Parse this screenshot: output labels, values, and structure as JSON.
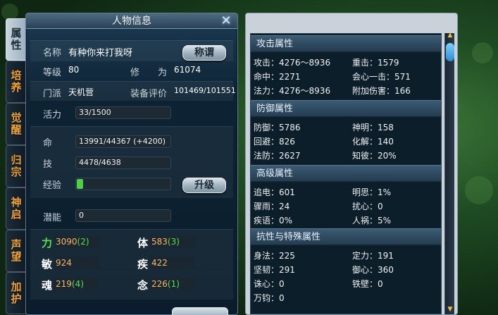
{
  "panel": {
    "title": "人物信息",
    "close_icon": "close-icon"
  },
  "tabs": [
    "属性",
    "培养",
    "觉醒",
    "归宗",
    "神启",
    "声望",
    "加护"
  ],
  "profile": {
    "name_label": "名称",
    "name_value": "有种你来打我呀",
    "title_button": "称谓",
    "level_label": "等级",
    "level_value": "80",
    "cultivation_label": "修　　为",
    "cultivation_value": "61074",
    "sect_label": "门派",
    "sect_value": "天机营",
    "gear_label": "装备评价",
    "gear_value": "101469/101551",
    "vitality_label": "活力",
    "vitality_value": "33/1500",
    "life_label": "命",
    "life_value": "13991/44367 (+4200)",
    "skill_label": "技",
    "skill_value": "4478/4638",
    "exp_label": "经验",
    "exp_fraction": 0.07,
    "upgrade_button": "升级",
    "potential_label": "潜能",
    "potential_value": "0"
  },
  "stats": {
    "strength_label": "力",
    "strength_value": "3090",
    "strength_bonus": "(2)",
    "physique_label": "体",
    "physique_value": "583",
    "physique_bonus": "(3)",
    "agility_label": "敏",
    "agility_value": "924",
    "speed_label": "疾",
    "speed_value": "422",
    "soul_label": "魂",
    "soul_value": "219",
    "soul_bonus": "(4)",
    "mind_label": "念",
    "mind_value": "226",
    "mind_bonus": "(1)"
  },
  "sections": {
    "attack": {
      "title": "攻击属性",
      "items": [
        "攻击：4276～8936",
        "重击：1579",
        "命中：2271",
        "会心一击：571",
        "法力：4276～8936",
        "附加伤害：166"
      ]
    },
    "defense": {
      "title": "防御属性",
      "items": [
        "防御：5786",
        "神明：158",
        "回避：826",
        "化解：140",
        "法防：2627",
        "知彼：20%"
      ]
    },
    "advanced": {
      "title": "高级属性",
      "items": [
        "追电：601",
        "明思：1%",
        "骤雨：24",
        "扰心：0",
        "疾语：0%",
        "人祸：5%"
      ]
    },
    "resist": {
      "title": "抗性与特殊属性",
      "items": [
        "身法：225",
        "定力：191",
        "坚韧：291",
        "御心：360",
        "诛心：0",
        "铁壁：0",
        "万钧：0"
      ]
    }
  },
  "colors": {
    "accent_orange": "#f0a43a",
    "bonus_green": "#58e052",
    "exp_green": "#4cd046"
  }
}
